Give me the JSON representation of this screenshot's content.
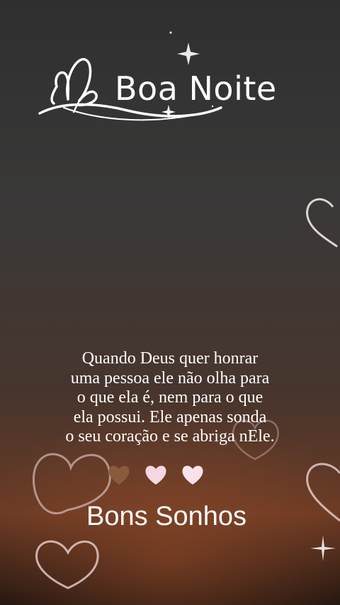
{
  "header": {
    "title": "Boa Noite",
    "logo_icon": "butterfly-icon"
  },
  "quote": {
    "lines": [
      "Quando Deus quer honrar",
      "uma pessoa ele não olha para",
      "o que ela é, nem para o que",
      "ela possui. Ele apenas sonda",
      "o seu coração e se abriga nEle."
    ]
  },
  "hearts_row": {
    "icons": [
      "heart-icon",
      "heart-icon",
      "heart-icon"
    ],
    "colors": [
      "#8a5a3c",
      "#f6d7e3",
      "#f9e3ea"
    ]
  },
  "closing": {
    "text": "Bons Sonhos"
  },
  "colors": {
    "bg_top": "#3a3a3a",
    "bg_bottom": "#4a2a18",
    "text": "#ffffff"
  }
}
